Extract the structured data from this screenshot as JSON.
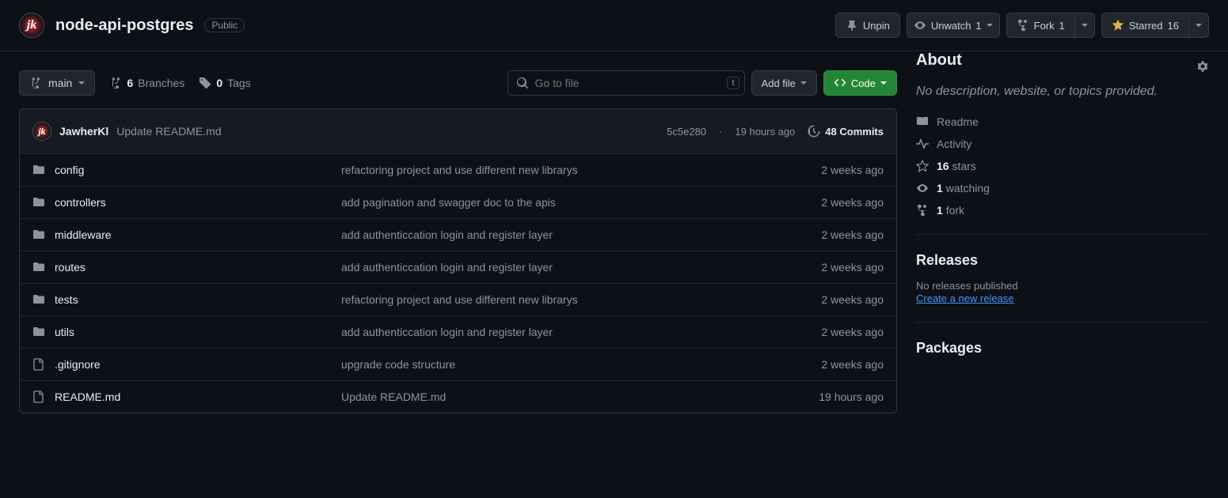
{
  "header": {
    "avatar_initial": "jk",
    "repo_name": "node-api-postgres",
    "visibility": "Public",
    "actions": {
      "unpin": "Unpin",
      "unwatch": "Unwatch",
      "unwatch_count": "1",
      "fork": "Fork",
      "fork_count": "1",
      "starred": "Starred",
      "starred_count": "16"
    }
  },
  "toolbar": {
    "branch_name": "main",
    "branches_count": "6",
    "branches_label": "Branches",
    "tags_count": "0",
    "tags_label": "Tags",
    "search_placeholder": "Go to file",
    "search_kbd": "t",
    "add_file": "Add file",
    "code": "Code"
  },
  "latest_commit": {
    "avatar_initial": "jk",
    "author": "JawherKl",
    "message": "Update README.md",
    "sha": "5c5e280",
    "time": "19 hours ago",
    "commits_label": "48 Commits"
  },
  "files": [
    {
      "type": "dir",
      "name": "config",
      "msg": "refactoring project and use different new librarys",
      "date": "2 weeks ago"
    },
    {
      "type": "dir",
      "name": "controllers",
      "msg": "add pagination and swagger doc to the apis",
      "date": "2 weeks ago"
    },
    {
      "type": "dir",
      "name": "middleware",
      "msg": "add authenticcation login and register layer",
      "date": "2 weeks ago"
    },
    {
      "type": "dir",
      "name": "routes",
      "msg": "add authenticcation login and register layer",
      "date": "2 weeks ago"
    },
    {
      "type": "dir",
      "name": "tests",
      "msg": "refactoring project and use different new librarys",
      "date": "2 weeks ago"
    },
    {
      "type": "dir",
      "name": "utils",
      "msg": "add authenticcation login and register layer",
      "date": "2 weeks ago"
    },
    {
      "type": "file",
      "name": ".gitignore",
      "msg": "upgrade code structure",
      "date": "2 weeks ago"
    },
    {
      "type": "file",
      "name": "README.md",
      "msg": "Update README.md",
      "date": "19 hours ago"
    }
  ],
  "about": {
    "title": "About",
    "description": "No description, website, or topics provided.",
    "readme": "Readme",
    "activity": "Activity",
    "stars_count": "16",
    "stars_label": "stars",
    "watching_count": "1",
    "watching_label": "watching",
    "forks_count": "1",
    "forks_label": "fork"
  },
  "releases": {
    "title": "Releases",
    "empty": "No releases published",
    "create": "Create a new release"
  },
  "packages": {
    "title": "Packages"
  }
}
